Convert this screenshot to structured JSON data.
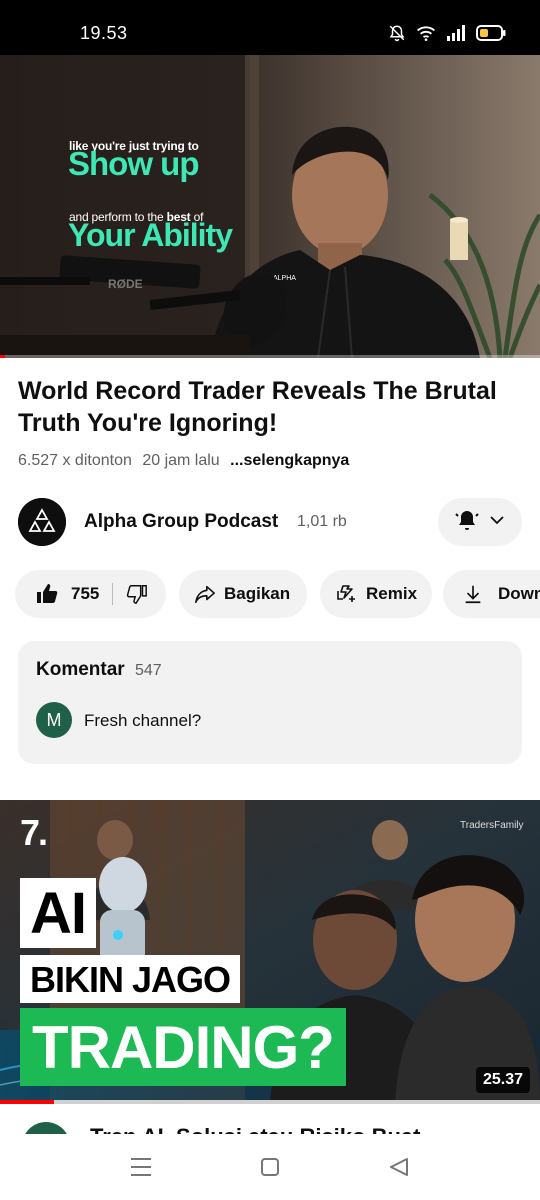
{
  "status_bar": {
    "time": "19.53",
    "icons": [
      "bell-off-icon",
      "wifi-icon",
      "signal-icon",
      "battery-icon"
    ]
  },
  "player": {
    "overlay_line1": "like you're just trying to",
    "overlay_big1": "Show up",
    "overlay_line2_pre": "and perform to the ",
    "overlay_line2_bold": "best",
    "overlay_line2_post": " of",
    "overlay_big2": "Your Ability",
    "mic_brand": "RØDE",
    "shirt_logo": "ALPHA",
    "progress_fraction": 0.01
  },
  "video": {
    "title": "World Record Trader Reveals The Brutal Truth You're Ignoring!",
    "views": "6.527 x ditonton",
    "age": "20 jam lalu",
    "more_label": "...selengkapnya"
  },
  "channel": {
    "name": "Alpha Group Podcast",
    "subscribers": "1,01 rb"
  },
  "actions": {
    "likes": "755",
    "share": "Bagikan",
    "remix": "Remix",
    "download": "Download"
  },
  "comments": {
    "title": "Komentar",
    "count": "547",
    "top_comment": {
      "avatar_letter": "M",
      "text": "Fresh channel?"
    }
  },
  "next_video": {
    "channel_logo": "7.",
    "watermark": "TradersFamily",
    "headline_1": "AI",
    "headline_2": "BIKIN JAGO",
    "headline_3": "TRADING?",
    "duration": "25.37",
    "title_peek": "Tren AI, Solusi atau Risiko Buat",
    "watch_progress_fraction": 0.1
  },
  "colors": {
    "accent_green": "#3ee8b5",
    "trading_green": "#1db954",
    "progress_red": "#ff0000"
  }
}
